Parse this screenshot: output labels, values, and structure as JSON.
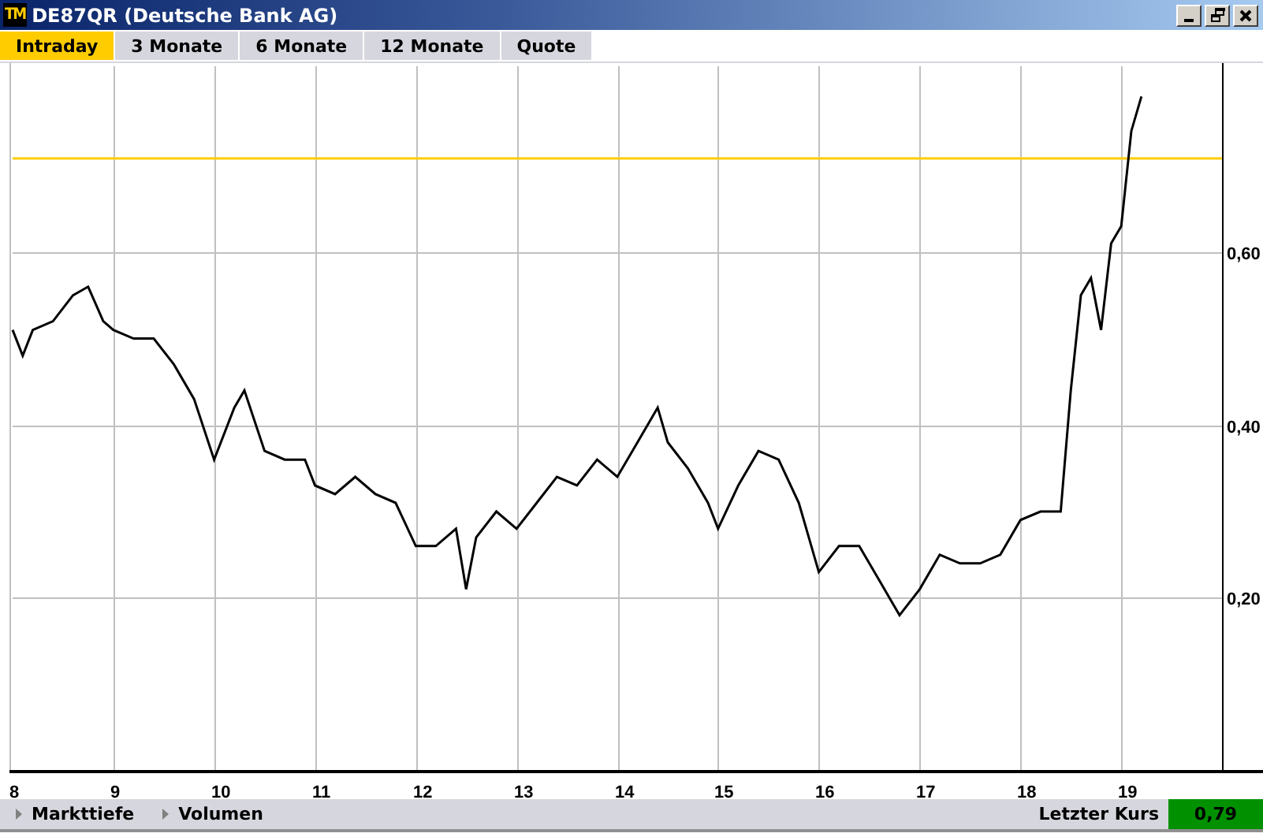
{
  "window": {
    "logo": "TM",
    "title": "DE87QR (Deutsche Bank AG)"
  },
  "tabs": [
    {
      "label": "Intraday",
      "selected": true
    },
    {
      "label": "3 Monate",
      "selected": false
    },
    {
      "label": "6 Monate",
      "selected": false
    },
    {
      "label": "12 Monate",
      "selected": false
    },
    {
      "label": "Quote",
      "selected": false
    }
  ],
  "chart": {
    "chart_data": {
      "type": "line",
      "xlim": [
        8,
        20
      ],
      "ylim": [
        0,
        0.815
      ],
      "xticks": [
        8,
        9,
        10,
        11,
        12,
        13,
        14,
        15,
        16,
        17,
        18,
        19
      ],
      "yticks": [
        {
          "value": 0.2,
          "label": "0,20"
        },
        {
          "value": 0.4,
          "label": "0,40"
        },
        {
          "value": 0.6,
          "label": "0,60"
        }
      ],
      "x": [
        8.0,
        8.1,
        8.2,
        8.4,
        8.6,
        8.75,
        8.9,
        9.0,
        9.2,
        9.4,
        9.6,
        9.8,
        10.0,
        10.2,
        10.3,
        10.5,
        10.7,
        10.9,
        11.0,
        11.2,
        11.4,
        11.6,
        11.8,
        12.0,
        12.2,
        12.4,
        12.5,
        12.6,
        12.8,
        13.0,
        13.2,
        13.4,
        13.6,
        13.8,
        14.0,
        14.2,
        14.4,
        14.5,
        14.7,
        14.9,
        15.0,
        15.2,
        15.4,
        15.6,
        15.8,
        16.0,
        16.2,
        16.4,
        16.6,
        16.8,
        17.0,
        17.2,
        17.4,
        17.6,
        17.8,
        18.0,
        18.2,
        18.4,
        18.5,
        18.6,
        18.7,
        18.8,
        18.9,
        19.0,
        19.1,
        19.2
      ],
      "grid": true,
      "series": [
        {
          "color": "#000000",
          "values": [
            0.51,
            0.48,
            0.51,
            0.52,
            0.55,
            0.56,
            0.52,
            0.51,
            0.5,
            0.5,
            0.47,
            0.43,
            0.36,
            0.42,
            0.44,
            0.37,
            0.36,
            0.36,
            0.33,
            0.32,
            0.34,
            0.32,
            0.31,
            0.26,
            0.26,
            0.28,
            0.21,
            0.27,
            0.3,
            0.28,
            0.31,
            0.34,
            0.33,
            0.36,
            0.34,
            0.38,
            0.42,
            0.38,
            0.35,
            0.31,
            0.28,
            0.33,
            0.37,
            0.36,
            0.31,
            0.23,
            0.26,
            0.26,
            0.22,
            0.18,
            0.21,
            0.25,
            0.24,
            0.24,
            0.25,
            0.29,
            0.3,
            0.3,
            0.44,
            0.55,
            0.57,
            0.51,
            0.61,
            0.63,
            0.74,
            0.78
          ]
        }
      ],
      "ref_lines": [
        {
          "axis": "y",
          "value": 0.71,
          "color": "#ffcc00"
        }
      ]
    }
  },
  "bottom_bar": {
    "links": [
      {
        "label": "Markttiefe"
      },
      {
        "label": "Volumen"
      }
    ],
    "last_price": {
      "label": "Letzter Kurs",
      "value": "0,79"
    }
  }
}
